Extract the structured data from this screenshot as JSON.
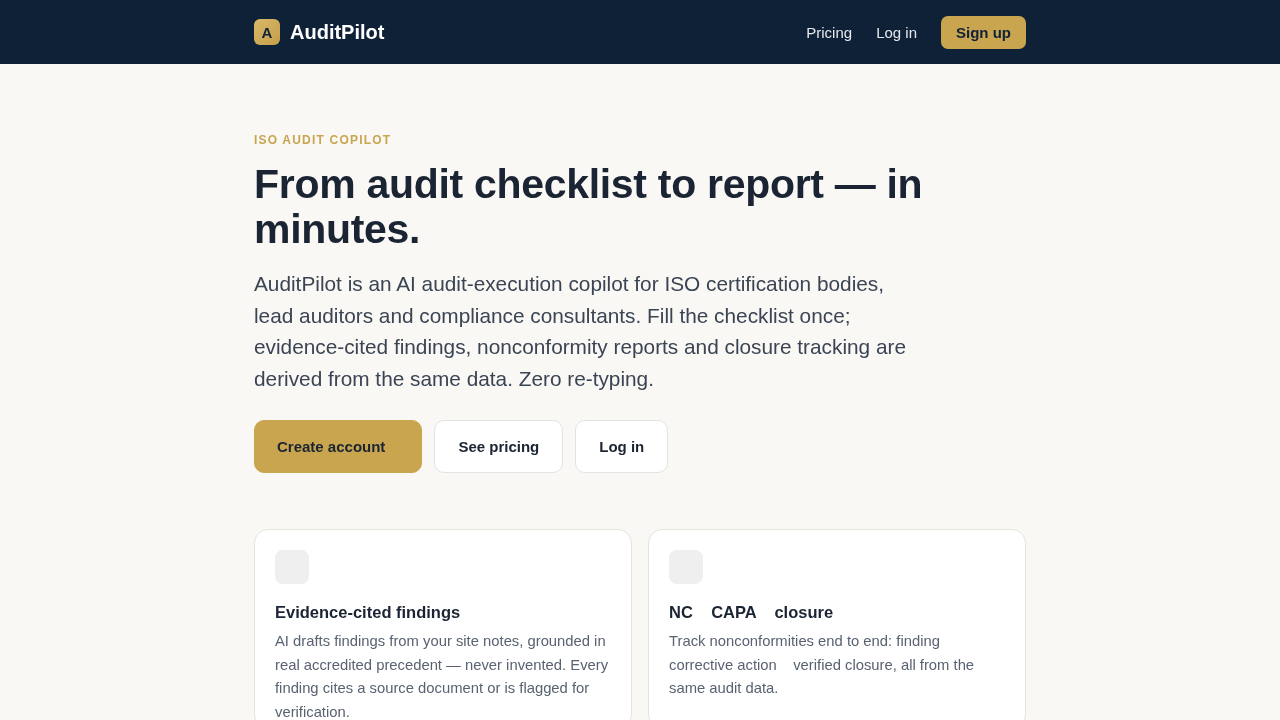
{
  "nav": {
    "logo_letter": "A",
    "brand": "AuditPilot",
    "links": [
      "Pricing",
      "Log in"
    ],
    "cta": "Sign up"
  },
  "hero": {
    "eyebrow": "ISO AUDIT COPILOT",
    "title": "From audit checklist to report — in minutes.",
    "description": "AuditPilot is an AI audit-execution copilot for ISO certification bodies, lead auditors and compliance consultants. Fill the checklist once; evidence-cited findings, nonconformity reports and closure tracking are derived from the same data. Zero re-typing.",
    "buttons": [
      {
        "label": "Create account",
        "kind": "primary"
      },
      {
        "label": "See pricing",
        "kind": "secondary"
      },
      {
        "label": "Log in",
        "kind": "secondary"
      }
    ]
  },
  "features": [
    {
      "title": "Evidence-cited findings",
      "description": "AI drafts findings from your site notes, grounded in real accredited precedent — never invented. Every finding cites a source document or is flagged for verification."
    },
    {
      "title": "NC    CAPA    closure",
      "description": "Track nonconformities end to end: finding    corrective action    verified closure, all from the same audit data."
    }
  ]
}
